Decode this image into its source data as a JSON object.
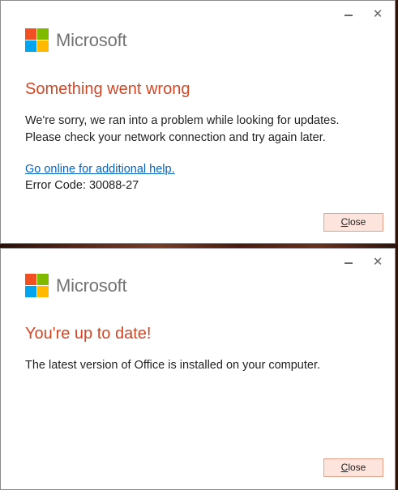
{
  "dialogs": [
    {
      "brand": "Microsoft",
      "heading": "Something went wrong",
      "message_line1": "We're sorry, we ran into a problem while looking for updates.",
      "message_line2": "Please check your network connection and try again later.",
      "help_link": "Go online for additional help.",
      "error_code": "Error Code: 30088-27",
      "close_button_first": "C",
      "close_button_rest": "lose",
      "minimize_icon": "minimize-icon",
      "close_icon": "close-icon"
    },
    {
      "brand": "Microsoft",
      "heading": "You're up to date!",
      "message_line1": "The latest version of Office is installed on your computer.",
      "close_button_first": "C",
      "close_button_rest": "lose",
      "minimize_icon": "minimize-icon",
      "close_icon": "close-icon"
    }
  ],
  "colors": {
    "heading": "#d24726",
    "link": "#0563c1",
    "logo_red": "#f25022",
    "logo_green": "#7fba00",
    "logo_blue": "#00a4ef",
    "logo_yellow": "#ffb900",
    "button_bg": "#fde4dc"
  }
}
